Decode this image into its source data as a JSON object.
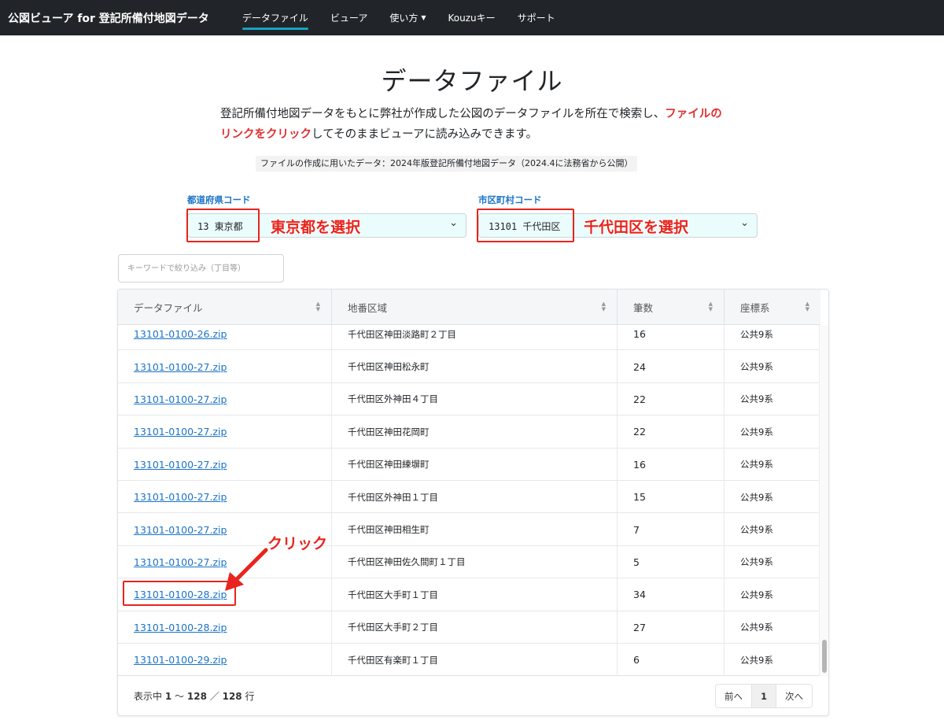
{
  "navbar": {
    "brand": "公図ビューア for 登記所備付地図データ",
    "items": [
      {
        "label": "データファイル",
        "active": true
      },
      {
        "label": "ビューア"
      },
      {
        "label": "使い方",
        "dropdown": true
      },
      {
        "label": "Kouzuキー"
      },
      {
        "label": "サポート"
      }
    ]
  },
  "header": {
    "title": "データファイル",
    "desc_part1": "登記所備付地図データをもとに弊社が作成した公図のデータファイルを所在で検索し、",
    "desc_highlight": "ファイルのリンクをクリック",
    "desc_part2": "してそのままビューアに読み込みできます。",
    "note": "ファイルの作成に用いたデータ：2024年版登記所備付地図データ（2024.4に法務省から公開）"
  },
  "filters": {
    "prefecture_label": "都道府県コード",
    "prefecture_value": "13 東京都",
    "prefecture_annotation": "東京都を選択",
    "city_label": "市区町村コード",
    "city_value": "13101 千代田区",
    "city_annotation": "千代田区を選択",
    "keyword_placeholder": "キーワードで絞り込み（丁目等）"
  },
  "table": {
    "columns": [
      "データファイル",
      "地番区域",
      "筆数",
      "座標系"
    ],
    "rows": [
      {
        "file": "13101-0100-26.zip",
        "area": "千代田区神田淡路町２丁目",
        "count": "16",
        "crs": "公共9系"
      },
      {
        "file": "13101-0100-27.zip",
        "area": "千代田区神田松永町",
        "count": "24",
        "crs": "公共9系"
      },
      {
        "file": "13101-0100-27.zip",
        "area": "千代田区外神田４丁目",
        "count": "22",
        "crs": "公共9系"
      },
      {
        "file": "13101-0100-27.zip",
        "area": "千代田区神田花岡町",
        "count": "22",
        "crs": "公共9系"
      },
      {
        "file": "13101-0100-27.zip",
        "area": "千代田区神田練塀町",
        "count": "16",
        "crs": "公共9系"
      },
      {
        "file": "13101-0100-27.zip",
        "area": "千代田区外神田１丁目",
        "count": "15",
        "crs": "公共9系"
      },
      {
        "file": "13101-0100-27.zip",
        "area": "千代田区神田相生町",
        "count": "7",
        "crs": "公共9系"
      },
      {
        "file": "13101-0100-27.zip",
        "area": "千代田区神田佐久間町１丁目",
        "count": "5",
        "crs": "公共9系"
      },
      {
        "file": "13101-0100-28.zip",
        "area": "千代田区大手町１丁目",
        "count": "34",
        "crs": "公共9系"
      },
      {
        "file": "13101-0100-28.zip",
        "area": "千代田区大手町２丁目",
        "count": "27",
        "crs": "公共9系"
      },
      {
        "file": "13101-0100-29.zip",
        "area": "千代田区有楽町１丁目",
        "count": "6",
        "crs": "公共9系"
      }
    ],
    "footer_prefix": "表示中",
    "range_start": "1",
    "range_sep": "〜",
    "range_end": "128",
    "total_sep": "／",
    "total": "128",
    "footer_suffix": "行",
    "pager_prev": "前へ",
    "pager_current": "1",
    "pager_next": "次へ"
  },
  "annotations": {
    "click_label": "クリック",
    "accent_color": "#e8241c"
  }
}
